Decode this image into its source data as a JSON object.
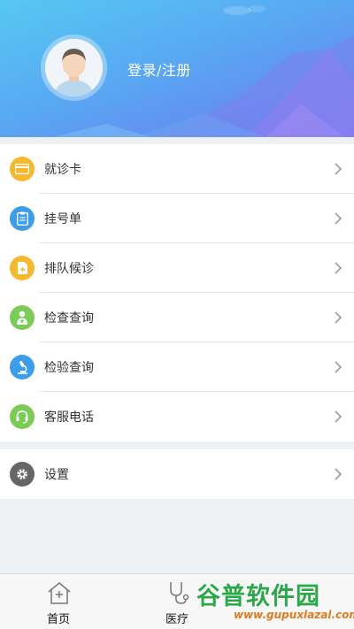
{
  "header": {
    "login_label": "登录/注册"
  },
  "menu": {
    "items": [
      {
        "label": "就诊卡",
        "icon": "card-icon",
        "color": "#f5b82e"
      },
      {
        "label": "挂号单",
        "icon": "clipboard-icon",
        "color": "#3d9de9"
      },
      {
        "label": "排队候诊",
        "icon": "queue-document-icon",
        "color": "#f5b82e"
      },
      {
        "label": "检查查询",
        "icon": "doctor-icon",
        "color": "#7ccb56"
      },
      {
        "label": "检验查询",
        "icon": "microscope-icon",
        "color": "#3d9de9"
      },
      {
        "label": "客服电话",
        "icon": "headset-icon",
        "color": "#7ccb56"
      }
    ]
  },
  "settings": {
    "label": "设置",
    "icon": "gear-icon",
    "color": "#666666"
  },
  "tabbar": {
    "tabs": [
      {
        "label": "首页",
        "icon": "home-icon"
      },
      {
        "label": "医疗",
        "icon": "stethoscope-icon"
      }
    ]
  },
  "watermark": {
    "brand": "谷普软件园",
    "url": "www.gupuxlazal.com"
  }
}
